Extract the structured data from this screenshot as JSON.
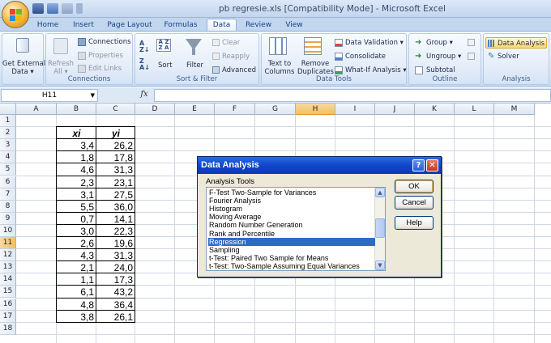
{
  "window": {
    "title": "pb regresie.xls  [Compatibility Mode] - Microsoft Excel"
  },
  "tabs": [
    "Home",
    "Insert",
    "Page Layout",
    "Formulas",
    "Data",
    "Review",
    "View"
  ],
  "active_tab": "Data",
  "ribbon": {
    "get_external": {
      "label1": "Get External",
      "label2": "Data ▾"
    },
    "connections": {
      "refresh1": "Refresh",
      "refresh2": "All ▾",
      "connections": "Connections",
      "properties": "Properties",
      "edit_links": "Edit Links",
      "group": "Connections"
    },
    "sort_filter": {
      "sort": "Sort",
      "filter": "Filter",
      "clear": "Clear",
      "reapply": "Reapply",
      "advanced": "Advanced",
      "group": "Sort & Filter"
    },
    "data_tools": {
      "t2c1": "Text to",
      "t2c2": "Columns",
      "rd1": "Remove",
      "rd2": "Duplicates",
      "validation": "Data Validation ▾",
      "consolidate": "Consolidate",
      "whatif": "What-If Analysis ▾",
      "group": "Data Tools"
    },
    "outline": {
      "group_btn": "Group ▾",
      "ungroup": "Ungroup ▾",
      "subtotal": "Subtotal",
      "group": "Outline"
    },
    "analysis": {
      "data_analysis": "Data Analysis",
      "solver": "Solver",
      "group": "Analysis"
    }
  },
  "formula_bar": {
    "name_box": "H11",
    "fx": "fx",
    "formula": ""
  },
  "columns": [
    "A",
    "B",
    "C",
    "D",
    "E",
    "F",
    "G",
    "H",
    "I",
    "J",
    "K",
    "L",
    "M"
  ],
  "selected_column": "H",
  "selected_row": "11",
  "rows": [
    "1",
    "2",
    "3",
    "4",
    "5",
    "6",
    "7",
    "8",
    "9",
    "10",
    "11",
    "12",
    "13",
    "14",
    "15",
    "16",
    "17",
    "18"
  ],
  "table": {
    "headers": [
      "xi",
      "yi"
    ],
    "xi": [
      "3,4",
      "1,8",
      "4,6",
      "2,3",
      "3,1",
      "5,5",
      "0,7",
      "3,0",
      "2,6",
      "4,3",
      "2,1",
      "1,1",
      "6,1",
      "4,8",
      "3,8"
    ],
    "yi": [
      "26,2",
      "17,8",
      "31,3",
      "23,1",
      "27,5",
      "36,0",
      "14,1",
      "22,3",
      "19,6",
      "31,3",
      "24,0",
      "17,3",
      "43,2",
      "36,4",
      "26,1"
    ]
  },
  "dialog": {
    "title": "Data Analysis",
    "help": "?",
    "close": "✕",
    "label": "Analysis Tools",
    "items": [
      "F-Test Two-Sample for Variances",
      "Fourier Analysis",
      "Histogram",
      "Moving Average",
      "Random Number Generation",
      "Rank and Percentile",
      "Regression",
      "Sampling",
      "t-Test: Paired Two Sample for Means",
      "t-Test: Two-Sample Assuming Equal Variances"
    ],
    "selected": "Regression",
    "ok": "OK",
    "cancel": "Cancel",
    "help_btn": "Help"
  },
  "colors": {
    "selected_header": "#f1c15f",
    "list_selection": "#316ac5",
    "dialog_title": "#0a3ab6"
  }
}
